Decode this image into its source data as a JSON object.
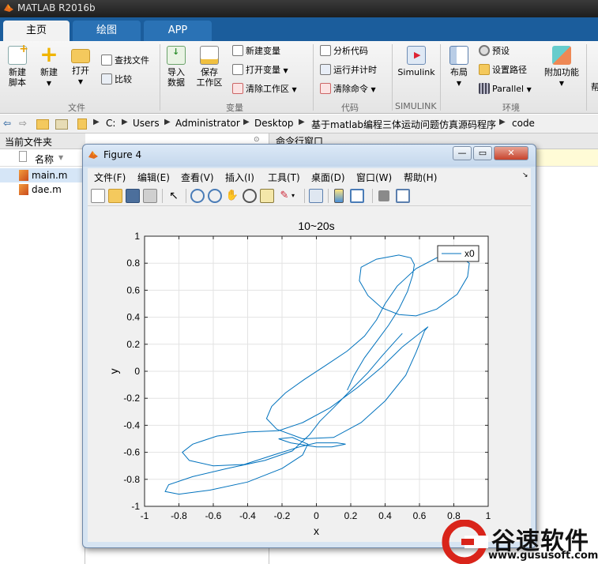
{
  "app": {
    "title": "MATLAB R2016b"
  },
  "tabs": [
    {
      "label": "主页",
      "active": true
    },
    {
      "label": "绘图",
      "active": false
    },
    {
      "label": "APP",
      "active": false
    }
  ],
  "ribbon": {
    "file": {
      "new_script": [
        "新建",
        "脚本"
      ],
      "new": "新建",
      "open": "打开",
      "find_files": "查找文件",
      "compare": "比较",
      "section": "文件"
    },
    "variable": {
      "import": [
        "导入",
        "数据"
      ],
      "save_workspace": [
        "保存",
        "工作区"
      ],
      "new_variable": "新建变量",
      "open_variable": "打开变量",
      "clear_workspace": "清除工作区",
      "section": "变量"
    },
    "code": {
      "analyze": "分析代码",
      "run_time": "运行并计时",
      "clear_commands": "清除命令",
      "section": "代码"
    },
    "simulink": {
      "label": "Simulink",
      "section": "SIMULINK"
    },
    "environment": {
      "layout": "布局",
      "preferences": "预设",
      "set_path": "设置路径",
      "parallel": "Parallel",
      "addons": "附加功能",
      "section": "环境"
    },
    "extra": "帮"
  },
  "address": {
    "crumbs": [
      "C:",
      "Users",
      "Administrator",
      "Desktop",
      "基于matlab编程三体运动问题仿真源码程序",
      "code"
    ]
  },
  "current_folder": {
    "title": "当前文件夹",
    "column": "名称",
    "files": [
      {
        "name": "main.m",
        "selected": true
      },
      {
        "name": "dae.m",
        "selected": false
      }
    ]
  },
  "command_window": {
    "title": "命令行窗口"
  },
  "figure": {
    "title": "Figure 4",
    "menu": [
      "文件(F)",
      "编辑(E)",
      "查看(V)",
      "插入(I)",
      "工具(T)",
      "桌面(D)",
      "窗口(W)",
      "帮助(H)"
    ],
    "win_buttons": {
      "minimize": "—",
      "maximize": "▭",
      "close": "✕"
    }
  },
  "chart_data": {
    "type": "line",
    "title": "10~20s",
    "xlabel": "x",
    "ylabel": "y",
    "xlim": [
      -1,
      1
    ],
    "ylim": [
      -1,
      1
    ],
    "xticks": [
      -1,
      -0.8,
      -0.6,
      -0.4,
      -0.2,
      0,
      0.2,
      0.4,
      0.6,
      0.8,
      1
    ],
    "yticks": [
      -1,
      -0.8,
      -0.6,
      -0.4,
      -0.2,
      0,
      0.2,
      0.4,
      0.6,
      0.8,
      1
    ],
    "xtick_labels": [
      "-1",
      "-0.8",
      "-0.6",
      "-0.4",
      "-0.2",
      "0",
      "0.2",
      "0.4",
      "0.6",
      "0.8",
      "1"
    ],
    "ytick_labels": [
      "-1",
      "-0.8",
      "-0.6",
      "-0.4",
      "-0.2",
      "0",
      "0.2",
      "0.4",
      "0.6",
      "0.8",
      "1"
    ],
    "grid": true,
    "legend": {
      "entries": [
        "x0"
      ],
      "position": "top-right"
    },
    "series": [
      {
        "name": "x0",
        "color": "#0072bd",
        "points": [
          [
            0.18,
            -0.14
          ],
          [
            0.22,
            -0.03
          ],
          [
            0.28,
            0.1
          ],
          [
            0.35,
            0.22
          ],
          [
            0.42,
            0.34
          ],
          [
            0.48,
            0.46
          ],
          [
            0.53,
            0.59
          ],
          [
            0.56,
            0.71
          ],
          [
            0.57,
            0.79
          ],
          [
            0.55,
            0.84
          ],
          [
            0.48,
            0.86
          ],
          [
            0.35,
            0.83
          ],
          [
            0.26,
            0.77
          ],
          [
            0.25,
            0.67
          ],
          [
            0.3,
            0.56
          ],
          [
            0.38,
            0.47
          ],
          [
            0.48,
            0.42
          ],
          [
            0.58,
            0.41
          ],
          [
            0.7,
            0.46
          ],
          [
            0.82,
            0.57
          ],
          [
            0.88,
            0.7
          ],
          [
            0.89,
            0.8
          ],
          [
            0.82,
            0.86
          ],
          [
            0.7,
            0.84
          ],
          [
            0.58,
            0.76
          ],
          [
            0.47,
            0.63
          ],
          [
            0.4,
            0.5
          ],
          [
            0.35,
            0.38
          ],
          [
            0.28,
            0.26
          ],
          [
            0.18,
            0.15
          ],
          [
            0.05,
            0.04
          ],
          [
            -0.07,
            -0.06
          ],
          [
            -0.18,
            -0.16
          ],
          [
            -0.26,
            -0.26
          ],
          [
            -0.29,
            -0.35
          ],
          [
            -0.23,
            -0.43
          ],
          [
            -0.08,
            -0.5
          ],
          [
            0.1,
            -0.49
          ],
          [
            0.26,
            -0.38
          ],
          [
            0.4,
            -0.22
          ],
          [
            0.52,
            -0.03
          ],
          [
            0.58,
            0.14
          ],
          [
            0.63,
            0.3
          ],
          [
            0.65,
            0.33
          ],
          [
            0.6,
            0.28
          ],
          [
            0.5,
            0.18
          ],
          [
            0.38,
            0.03
          ],
          [
            0.24,
            -0.12
          ],
          [
            0.08,
            -0.27
          ],
          [
            -0.08,
            -0.38
          ],
          [
            -0.22,
            -0.44
          ],
          [
            -0.4,
            -0.45
          ],
          [
            -0.58,
            -0.48
          ],
          [
            -0.72,
            -0.54
          ],
          [
            -0.78,
            -0.6
          ],
          [
            -0.74,
            -0.66
          ],
          [
            -0.6,
            -0.7
          ],
          [
            -0.42,
            -0.69
          ],
          [
            -0.25,
            -0.62
          ],
          [
            -0.1,
            -0.56
          ],
          [
            0.0,
            -0.53
          ],
          [
            0.12,
            -0.53
          ],
          [
            0.17,
            -0.54
          ],
          [
            0.09,
            -0.56
          ],
          [
            0.0,
            -0.56
          ],
          [
            -0.15,
            -0.53
          ],
          [
            -0.22,
            -0.5
          ],
          [
            -0.14,
            -0.49
          ],
          [
            -0.05,
            -0.54
          ],
          [
            -0.08,
            -0.62
          ],
          [
            -0.2,
            -0.72
          ],
          [
            -0.4,
            -0.82
          ],
          [
            -0.62,
            -0.88
          ],
          [
            -0.8,
            -0.91
          ],
          [
            -0.88,
            -0.89
          ],
          [
            -0.86,
            -0.84
          ],
          [
            -0.72,
            -0.78
          ],
          [
            -0.52,
            -0.72
          ],
          [
            -0.3,
            -0.66
          ],
          [
            -0.14,
            -0.59
          ],
          [
            -0.04,
            -0.47
          ],
          [
            0.02,
            -0.37
          ],
          [
            0.1,
            -0.27
          ],
          [
            0.2,
            -0.14
          ],
          [
            0.3,
            -0.01
          ],
          [
            0.38,
            0.11
          ],
          [
            0.45,
            0.21
          ],
          [
            0.5,
            0.28
          ]
        ]
      }
    ]
  },
  "watermark": {
    "brand": "谷速软件",
    "url": "www.gususoft.com"
  }
}
